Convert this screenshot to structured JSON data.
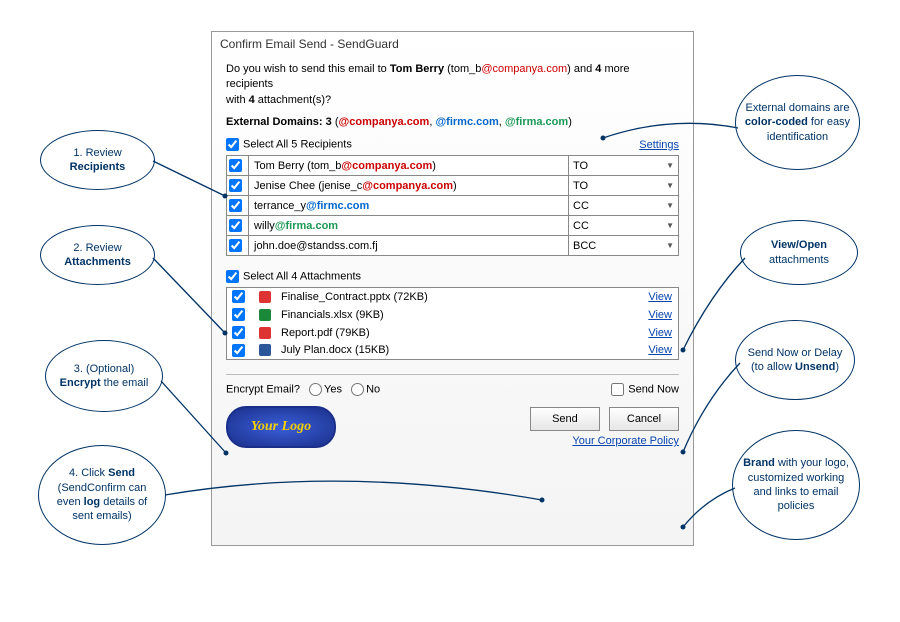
{
  "dialog": {
    "title": "Confirm Email Send - SendGuard",
    "prompt_pre": "Do you wish to send this email to ",
    "primary_name": "Tom Berry",
    "primary_addr_open": " (tom_b",
    "primary_addr_domain": "@companya.com",
    "primary_addr_close": ")",
    "prompt_mid": " and ",
    "more_recip_count": "4",
    "prompt_more": " more recipients",
    "prompt_with": "with ",
    "attach_count": "4",
    "prompt_attach_suffix": " attachment(s)?"
  },
  "ext": {
    "label": "External Domains: ",
    "count": "3",
    "open": " (",
    "d1": "@companya.com",
    "sep1": ", ",
    "d2": "@firmc.com",
    "sep2": ", ",
    "d3": "@firma.com",
    "close": ")"
  },
  "select_recip_label": "Select All 5 Recipients",
  "settings_label": "Settings",
  "recipients": [
    {
      "name_pre": "Tom Berry (tom_b",
      "domain": "@companya.com",
      "domain_class": "dom-a",
      "suffix": ")",
      "role": "TO"
    },
    {
      "name_pre": "Jenise Chee (jenise_c",
      "domain": "@companya.com",
      "domain_class": "dom-a",
      "suffix": ")",
      "role": "TO"
    },
    {
      "name_pre": "terrance_y",
      "domain": "@firmc.com",
      "domain_class": "dom-b",
      "suffix": "",
      "role": "CC"
    },
    {
      "name_pre": "willy",
      "domain": "@firma.com",
      "domain_class": "dom-c",
      "suffix": "",
      "role": "CC"
    },
    {
      "name_pre": "john.doe@standss.com.fj",
      "domain": "",
      "domain_class": "",
      "suffix": "",
      "role": "BCC"
    }
  ],
  "select_attach_label": "Select All 4 Attachments",
  "attachments": [
    {
      "name": "Finalise_Contract.pptx (72KB)",
      "icon": "fi-pdf"
    },
    {
      "name": "Financials.xlsx (9KB)",
      "icon": "fi-xls"
    },
    {
      "name": "Report.pdf (79KB)",
      "icon": "fi-pdf2"
    },
    {
      "name": "July Plan.docx (15KB)",
      "icon": "fi-doc"
    }
  ],
  "view_label": "View",
  "encrypt": {
    "label": "Encrypt Email?",
    "yes": "Yes",
    "no": "No"
  },
  "send_now_label": "Send Now",
  "buttons": {
    "send": "Send",
    "cancel": "Cancel"
  },
  "logo_text": "Your Logo",
  "policy_link": "Your Corporate Policy",
  "callouts": {
    "c1_pre": "1. Review ",
    "c1_bold": "Recipients",
    "c2_pre": "2. Review ",
    "c2_bold": "Attachments",
    "c3_pre": "3. (Optional) ",
    "c3_bold": "Encrypt",
    "c3_post": " the email",
    "c4_pre": "4. Click ",
    "c4_bold": "Send",
    "c4_post1": " (SendConfirm can even ",
    "c4_bold2": "log",
    "c4_post2": " details of sent emails)",
    "c5_pre": "External domains are ",
    "c5_bold": "color-coded",
    "c5_post": " for easy identification",
    "c6_bold": "View/Open",
    "c6_post": " attachments",
    "c7_pre": "Send Now or Delay (to allow ",
    "c7_bold": "Unsend",
    "c7_post": ")",
    "c8_bold": "Brand",
    "c8_post": " with your logo, customized working and links to email policies"
  }
}
